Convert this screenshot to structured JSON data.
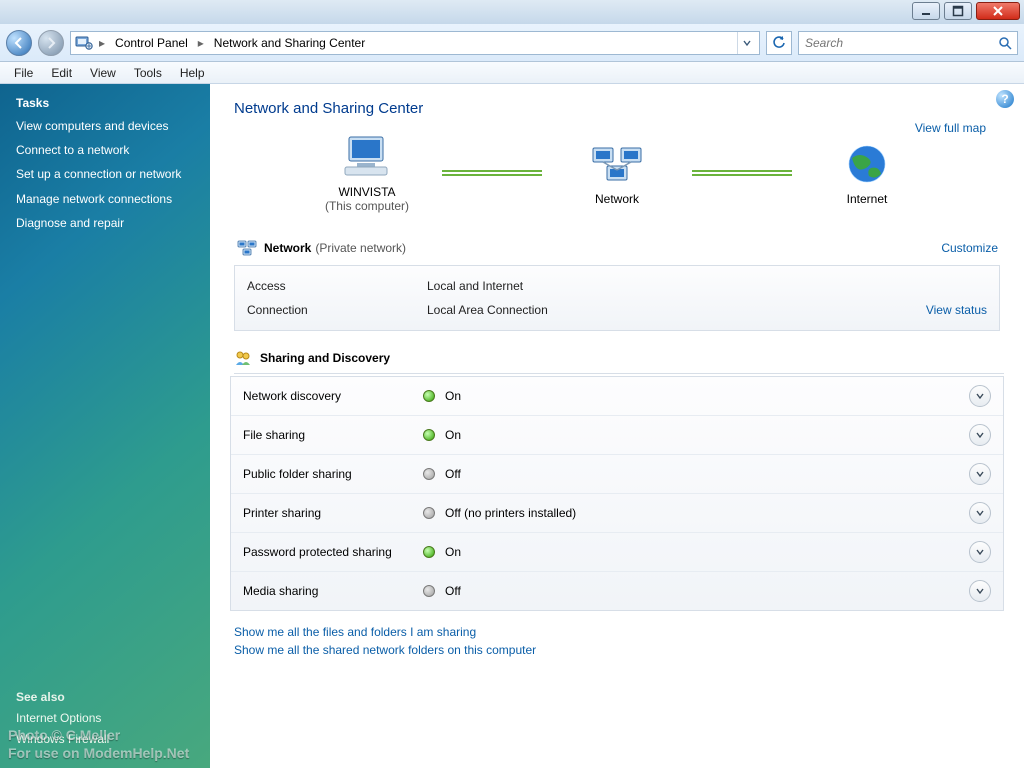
{
  "titlebar": {},
  "address": {
    "crumb1": "Control Panel",
    "crumb2": "Network and Sharing Center",
    "search_placeholder": "Search"
  },
  "menu": {
    "items": [
      "File",
      "Edit",
      "View",
      "Tools",
      "Help"
    ]
  },
  "sidebar": {
    "tasks_heading": "Tasks",
    "tasks": [
      "View computers and devices",
      "Connect to a network",
      "Set up a connection or network",
      "Manage network connections",
      "Diagnose and repair"
    ],
    "seealso_heading": "See also",
    "seealso": [
      "Internet Options",
      "Windows Firewall"
    ]
  },
  "page": {
    "heading": "Network and Sharing Center",
    "view_full_map": "View full map",
    "node_pc_name": "WINVISTA",
    "node_pc_sub": "(This computer)",
    "node_network": "Network",
    "node_internet": "Internet",
    "network_block": {
      "title": "Network",
      "subtitle": "(Private network)",
      "customize": "Customize",
      "access_label": "Access",
      "access_value": "Local and Internet",
      "connection_label": "Connection",
      "connection_value": "Local Area Connection",
      "view_status": "View status"
    },
    "sd_heading": "Sharing and Discovery",
    "sd_rows": [
      {
        "label": "Network discovery",
        "state": "on",
        "value": "On"
      },
      {
        "label": "File sharing",
        "state": "on",
        "value": "On"
      },
      {
        "label": "Public folder sharing",
        "state": "off",
        "value": "Off"
      },
      {
        "label": "Printer sharing",
        "state": "off",
        "value": "Off (no printers installed)"
      },
      {
        "label": "Password protected sharing",
        "state": "on",
        "value": "On"
      },
      {
        "label": "Media sharing",
        "state": "off",
        "value": "Off"
      }
    ],
    "link_files": "Show me all the files and folders I am sharing",
    "link_folders": "Show me all the shared network folders on this computer"
  },
  "watermark": {
    "line1": "Photo © C.Meller",
    "line2": "For use on ModemHelp.Net"
  }
}
